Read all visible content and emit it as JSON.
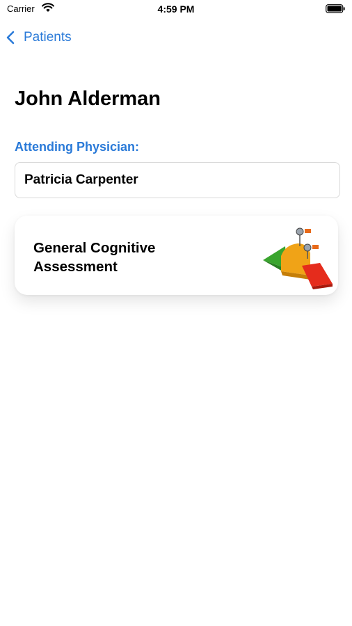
{
  "status_bar": {
    "carrier": "Carrier",
    "time": "4:59 PM"
  },
  "nav": {
    "back_label": "Patients"
  },
  "patient": {
    "name": "John Alderman"
  },
  "physician": {
    "label": "Attending Physician:",
    "value": "Patricia Carpenter"
  },
  "assessment_card": {
    "title": "General Cognitive Assessment",
    "icon": "cognitive-scale-chart-icon"
  },
  "colors": {
    "accent": "#2a7ad8",
    "field_border": "#d9d9d9",
    "scale_green": "#3aa52e",
    "scale_orange": "#f0a317",
    "scale_red": "#e52c1c"
  }
}
